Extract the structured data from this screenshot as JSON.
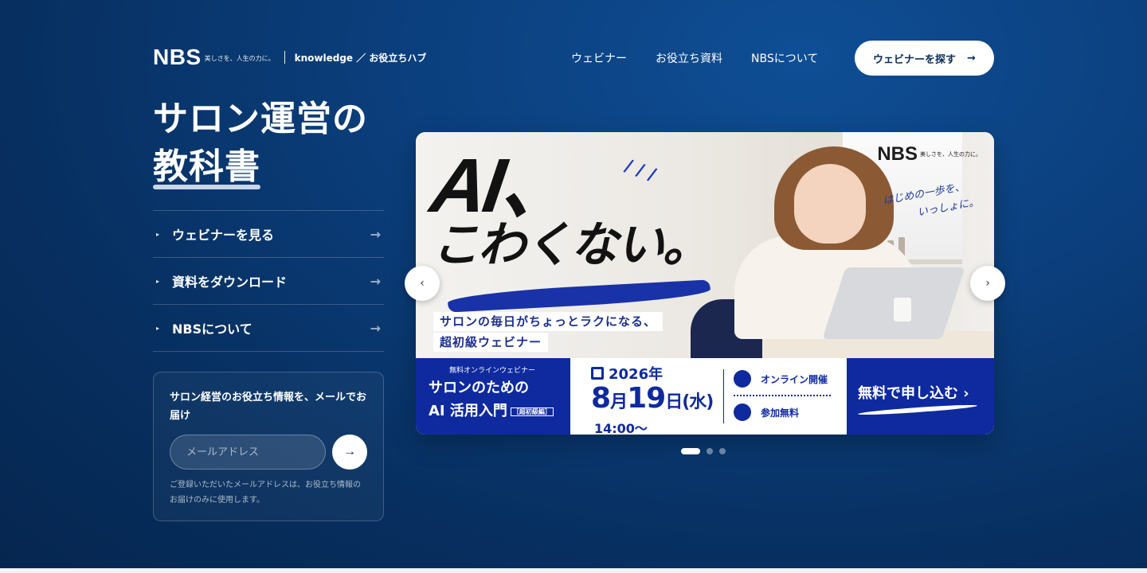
{
  "header": {
    "logo": "NBS",
    "logo_tagline": "美しさを、人生の力に。",
    "hub_label": "knowledge ／ お役立ちハブ",
    "nav": [
      "ウェビナー",
      "お役立ち資料",
      "NBSについて"
    ],
    "cta_label": "ウェビナーを探す",
    "cta_arrow": "→"
  },
  "hero": {
    "title_line1": "サロン運営の",
    "title_line2": "教科書"
  },
  "menu": [
    {
      "label": "ウェビナーを見る",
      "arrow": "→"
    },
    {
      "label": "資料をダウンロード",
      "arrow": "→"
    },
    {
      "label": "NBSについて",
      "arrow": "→"
    }
  ],
  "newsletter": {
    "title": "サロン経営のお役立ち情報を、メールでお届け",
    "placeholder": "メールアドレス",
    "submit": "→",
    "note": "ご登録いただいたメールアドレスは、お役立ち情報のお届けのみに使用します。"
  },
  "banner": {
    "brand": "NBS",
    "brand_tagline": "美しさを、人生の力に。",
    "headline1": "AI、",
    "headline2": "こわくない。",
    "script1": "はじめの一歩を、",
    "script2": "いっしょに。",
    "sub1": "サロンの毎日がちょっとラクになる、",
    "sub2": "超初級ウェビナー",
    "band_small": "無料オンラインウェビナー",
    "band_title1": "サロンのための",
    "band_title2": "AI 活用入門",
    "band_tag": "［超初級編］",
    "year": "2026年",
    "month": "8",
    "month_unit": "月",
    "day": "19",
    "day_unit": "日",
    "weekday": "(水)",
    "time": "14:00〜",
    "info1": "オンライン開催",
    "info2": "参加無料",
    "apply": "無料で申し込む ›"
  },
  "carousel": {
    "prev": "‹",
    "next": "›",
    "slides": 3,
    "active": 1
  },
  "colors": {
    "bg": "#0b3f7d",
    "band": "#0e2a9e",
    "white": "#ffffff"
  }
}
